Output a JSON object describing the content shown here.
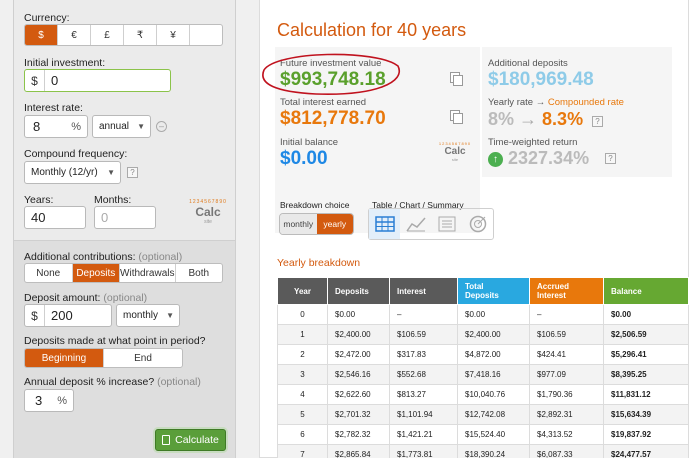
{
  "left": {
    "currency_label": "Currency:",
    "currencies": [
      "$",
      "€",
      "£",
      "₹",
      "¥",
      ""
    ],
    "initial_investment_label": "Initial investment:",
    "initial_investment_prefix": "$",
    "initial_investment_value": "0",
    "interest_rate_label": "Interest rate:",
    "interest_rate_value": "8",
    "interest_rate_suffix": "%",
    "interest_period": "annual",
    "compound_label": "Compound frequency:",
    "compound_value": "Monthly (12/yr)",
    "question_mark": "?",
    "years_label": "Years:",
    "years_value": "40",
    "months_label": "Months:",
    "months_placeholder": "0",
    "logo_top": "1234567890",
    "logo_text": "Calc",
    "logo_sub": "site",
    "contrib_label": "Additional contributions:",
    "contrib_optional": "(optional)",
    "contrib_options": [
      "None",
      "Deposits",
      "Withdrawals",
      "Both"
    ],
    "deposit_amount_label": "Deposit amount:",
    "deposit_amount_optional": "(optional)",
    "deposit_prefix": "$",
    "deposit_value": "200",
    "deposit_freq": "monthly",
    "deposit_timing_label": "Deposits made at what point in period?",
    "timing_options": [
      "Beginning",
      "End"
    ],
    "annual_increase_label": "Annual deposit % increase?",
    "annual_increase_optional": "(optional)",
    "annual_increase_value": "3",
    "annual_increase_suffix": "%",
    "calculate_label": "Calculate"
  },
  "right": {
    "title": "Calculation for 40 years",
    "future_label": "Future investment value",
    "future_value": "$993,748.18",
    "total_interest_label": "Total interest earned",
    "total_interest_value": "$812,778.70",
    "initial_balance_label": "Initial balance",
    "initial_balance_value": "$0.00",
    "additional_label": "Additional deposits",
    "additional_value": "$180,969.48",
    "yearly_rate_label": "Yearly rate",
    "arrow": "→",
    "compounded_label": "Compounded rate",
    "rate_from": "8%",
    "rate_to": "8.3%",
    "twr_label": "Time-weighted return",
    "twr_value": "2327.34%",
    "breakdown_label": "Breakdown choice",
    "breakdown_options": [
      "monthly",
      "yearly"
    ],
    "tcs_label": "Table / Chart / Summary",
    "yearly_breakdown": "Yearly breakdown",
    "colors": {
      "accent": "#d35a0f",
      "green": "#5aa02c",
      "blue": "#1e88e5",
      "light_blue": "#8ecbe8",
      "dark_header": "#5a5a5a",
      "deposits_header": "#29a8e0",
      "accrued_header": "#e8780c",
      "balance_header": "#66a832"
    },
    "table": {
      "headers": [
        "Year",
        "Deposits",
        "Interest",
        "Total\nDeposits",
        "Accrued\nInterest",
        "Balance"
      ],
      "rows": [
        [
          "0",
          "$0.00",
          "–",
          "$0.00",
          "–",
          "$0.00"
        ],
        [
          "1",
          "$2,400.00",
          "$106.59",
          "$2,400.00",
          "$106.59",
          "$2,506.59"
        ],
        [
          "2",
          "$2,472.00",
          "$317.83",
          "$4,872.00",
          "$424.41",
          "$5,296.41"
        ],
        [
          "3",
          "$2,546.16",
          "$552.68",
          "$7,418.16",
          "$977.09",
          "$8,395.25"
        ],
        [
          "4",
          "$2,622.60",
          "$813.27",
          "$10,040.76",
          "$1,790.36",
          "$11,831.12"
        ],
        [
          "5",
          "$2,701.32",
          "$1,101.94",
          "$12,742.08",
          "$2,892.31",
          "$15,634.39"
        ],
        [
          "6",
          "$2,782.32",
          "$1,421.21",
          "$15,524.40",
          "$4,313.52",
          "$19,837.92"
        ],
        [
          "7",
          "$2,865.84",
          "$1,773.81",
          "$18,390.24",
          "$6,087.33",
          "$24,477.57"
        ]
      ]
    }
  }
}
